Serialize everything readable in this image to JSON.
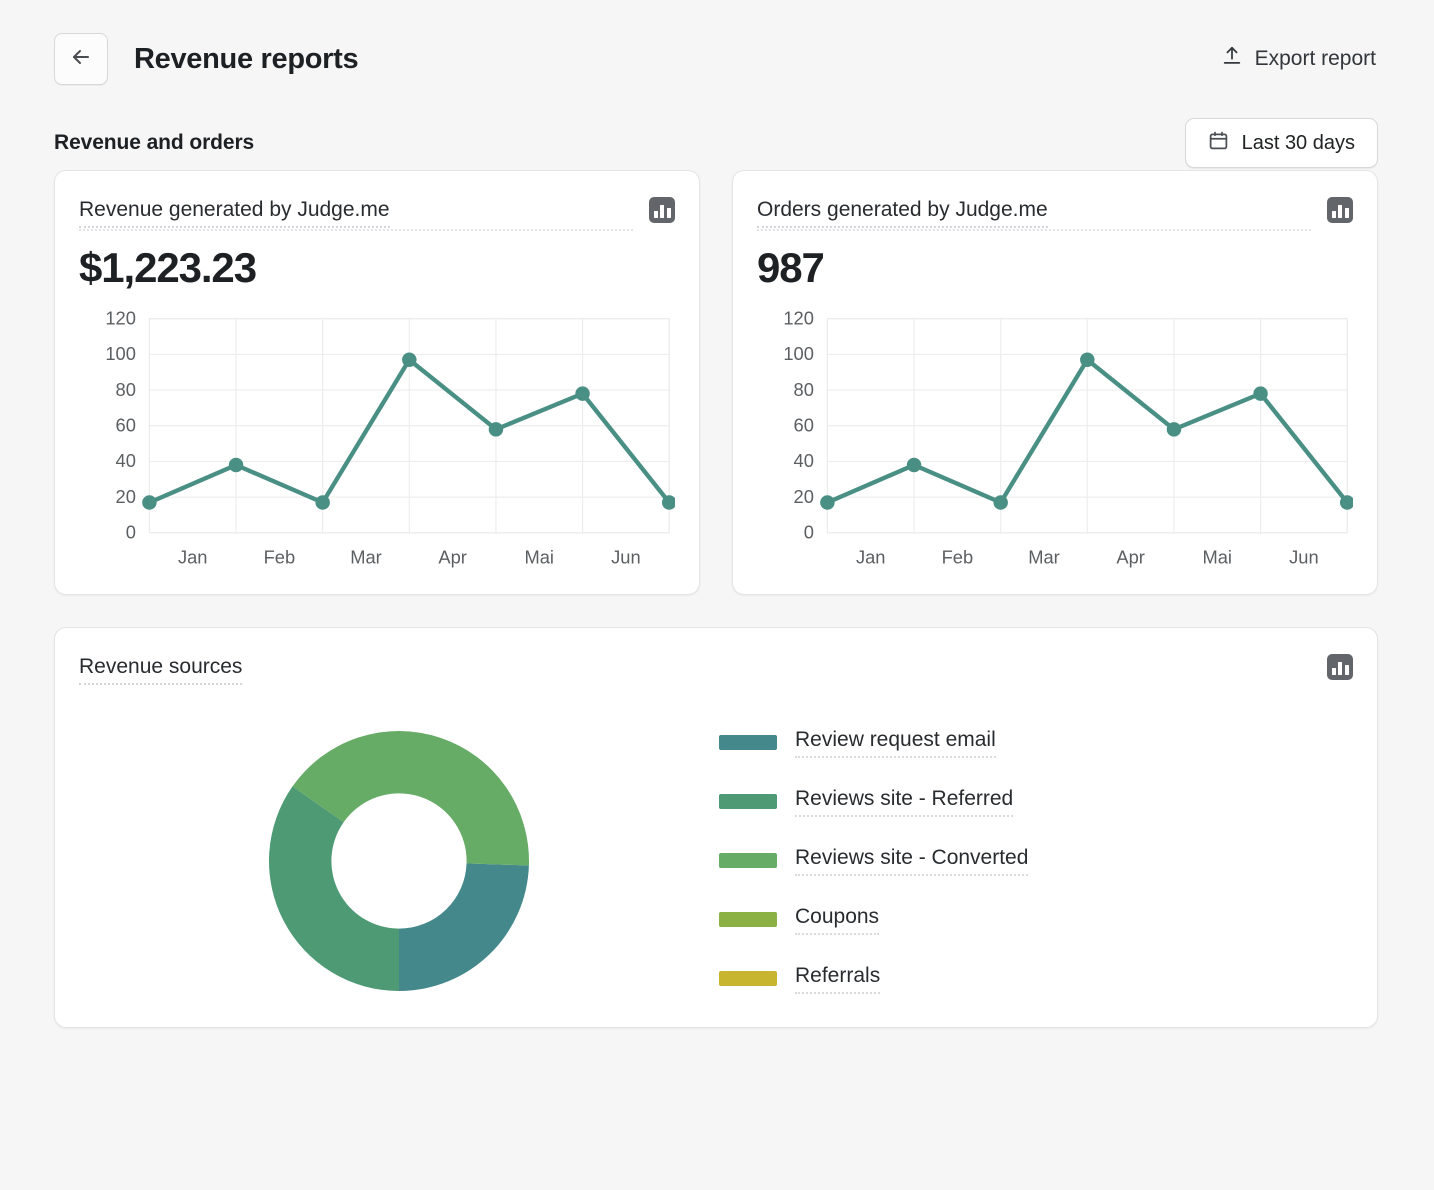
{
  "header": {
    "back_icon": "arrow-left-icon",
    "title": "Revenue reports",
    "export_icon": "export-upload-icon",
    "export_label": "Export report"
  },
  "section": {
    "title": "Revenue and orders",
    "daterange_icon": "calendar-icon",
    "daterange_label": "Last 30 days"
  },
  "cards": [
    {
      "title": "Revenue generated by Judge.me",
      "value": "$1,223.23",
      "icon": "bar-chart-icon"
    },
    {
      "title": "Orders generated by Judge.me",
      "value": "987",
      "icon": "bar-chart-icon"
    }
  ],
  "sources": {
    "title": "Revenue sources",
    "icon": "bar-chart-icon"
  },
  "colors": {
    "line": "#4a8f84",
    "grid": "#eceded",
    "axis_text": "#5c5f62",
    "page_bg": "#f6f6f7",
    "card_bg": "#ffffff",
    "card_border": "#e3e4e6",
    "text": "#202223"
  },
  "chart_data": [
    {
      "type": "line",
      "title": "Revenue generated by Judge.me",
      "xlabel": "",
      "ylabel": "",
      "categories": [
        "Jan",
        "Feb",
        "Mar",
        "Apr",
        "Mai",
        "Jun"
      ],
      "x": [
        0,
        1,
        2,
        3,
        4,
        5,
        6
      ],
      "values": [
        17,
        38,
        17,
        97,
        58,
        78,
        17
      ],
      "ylim": [
        0,
        120
      ],
      "yticks": [
        0,
        20,
        40,
        60,
        80,
        100,
        120
      ],
      "grid": true,
      "legend": "none",
      "series_color": "#4a8f84",
      "marker": "circle"
    },
    {
      "type": "line",
      "title": "Orders generated by Judge.me",
      "xlabel": "",
      "ylabel": "",
      "categories": [
        "Jan",
        "Feb",
        "Mar",
        "Apr",
        "Mai",
        "Jun"
      ],
      "x": [
        0,
        1,
        2,
        3,
        4,
        5,
        6
      ],
      "values": [
        17,
        38,
        17,
        97,
        58,
        78,
        17
      ],
      "ylim": [
        0,
        120
      ],
      "yticks": [
        0,
        20,
        40,
        60,
        80,
        100,
        120
      ],
      "grid": true,
      "legend": "none",
      "series_color": "#4a8f84",
      "marker": "circle"
    },
    {
      "type": "pie",
      "title": "Revenue sources",
      "donut": true,
      "inner_radius_ratio": 0.52,
      "legend": "right",
      "labels": [
        "Review request email",
        "Reviews site - Referred",
        "Reviews site - Converted",
        "Coupons",
        "Referrals"
      ],
      "colors": [
        "#44888c",
        "#4d9a75",
        "#66ab66",
        "#8bb043",
        "#c8b52f"
      ],
      "values": [
        24.4,
        34.7,
        40.9,
        0,
        0
      ],
      "slices": [
        {
          "label": "Review request email",
          "color": "#44888c",
          "start_deg": 92,
          "end_deg": 180,
          "percent": 24.4
        },
        {
          "label": "Reviews site - Referred",
          "color": "#4d9a75",
          "start_deg": 180,
          "end_deg": 305,
          "percent": 34.7
        },
        {
          "label": "Reviews site - Converted",
          "color": "#66ab66",
          "start_deg": 305,
          "end_deg": 452,
          "percent": 40.9
        },
        {
          "label": "Coupons",
          "color": "#8bb043",
          "start_deg": 452,
          "end_deg": 452,
          "percent": 0
        },
        {
          "label": "Referrals",
          "color": "#c8b52f",
          "start_deg": 452,
          "end_deg": 452,
          "percent": 0
        }
      ]
    }
  ]
}
